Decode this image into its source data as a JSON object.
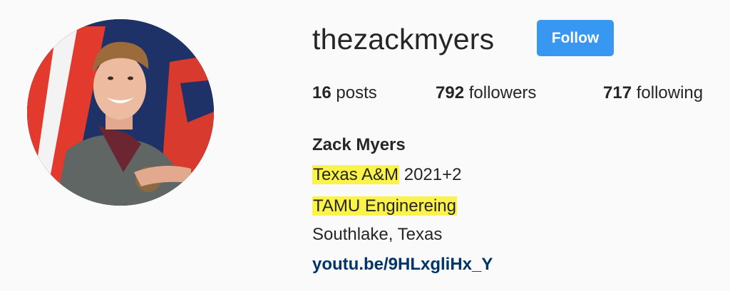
{
  "profile": {
    "username": "thezackmyers",
    "follow_label": "Follow",
    "posts_count": "16",
    "posts_label": "posts",
    "followers_count": "792",
    "followers_label": "followers",
    "following_count": "717",
    "following_label": "following",
    "full_name": "Zack Myers",
    "bio_school": "Texas A&M",
    "bio_school_suffix": "2021+2",
    "bio_department": "TAMU Enginereing",
    "bio_location": "Southlake, Texas",
    "bio_link": "youtu.be/9HLxgliHx_Y"
  },
  "colors": {
    "follow_button": "#3897f0",
    "highlight": "#fcf34a",
    "link": "#003569",
    "background": "#fafafa"
  }
}
